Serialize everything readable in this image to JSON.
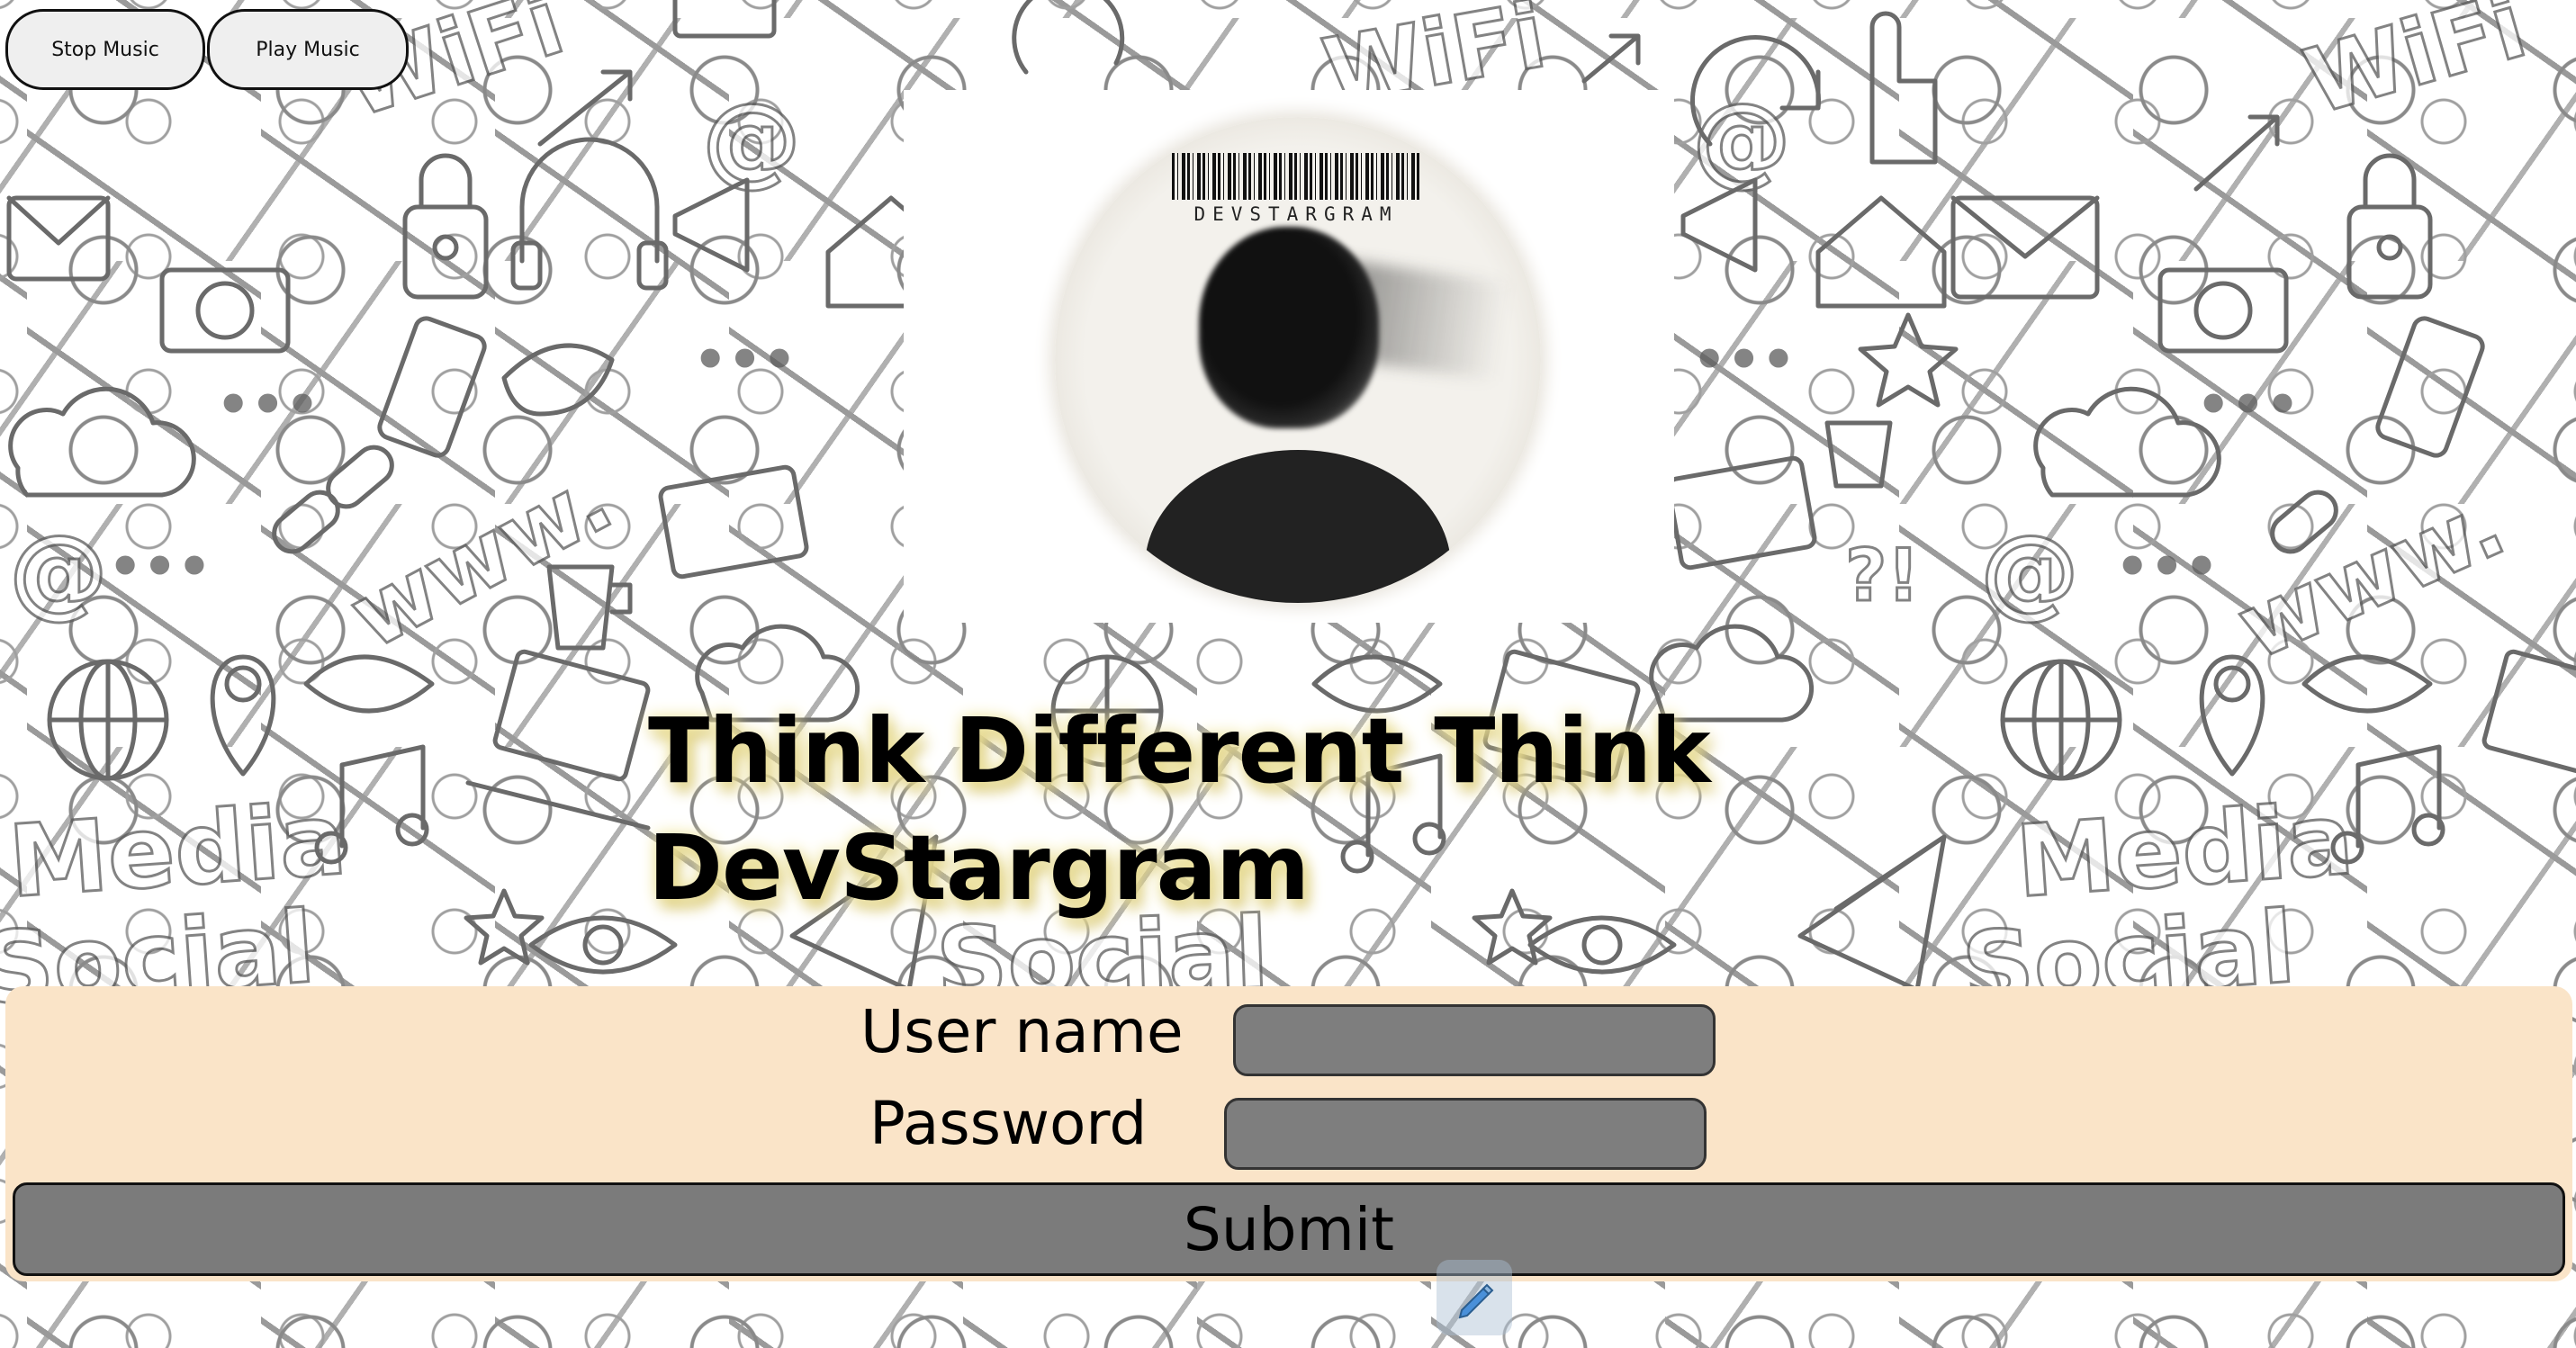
{
  "music_controls": {
    "stop_label": "Stop Music",
    "play_label": "Play Music"
  },
  "profile_image": {
    "barcode_text": "DEVSTARGRAM"
  },
  "tagline": {
    "line1": "Think Different Think",
    "line2": "DevStargram"
  },
  "background_doodles": {
    "wifi": "WiFi",
    "www": "www.",
    "media": "Media",
    "social": "Social",
    "at": "@",
    "qmark": "?!",
    "dots": "•••"
  },
  "login_form": {
    "username_label": "User name",
    "username_value": "",
    "password_label": "Password",
    "password_value": "",
    "submit_label": "Submit"
  },
  "colors": {
    "form_background": "#fae4c8",
    "input_background": "#7e7e7e",
    "submit_background": "#7b7b7b",
    "tagline_glow": "#f0e6a0"
  },
  "icons": {
    "floating_tool": "pencil-icon"
  }
}
